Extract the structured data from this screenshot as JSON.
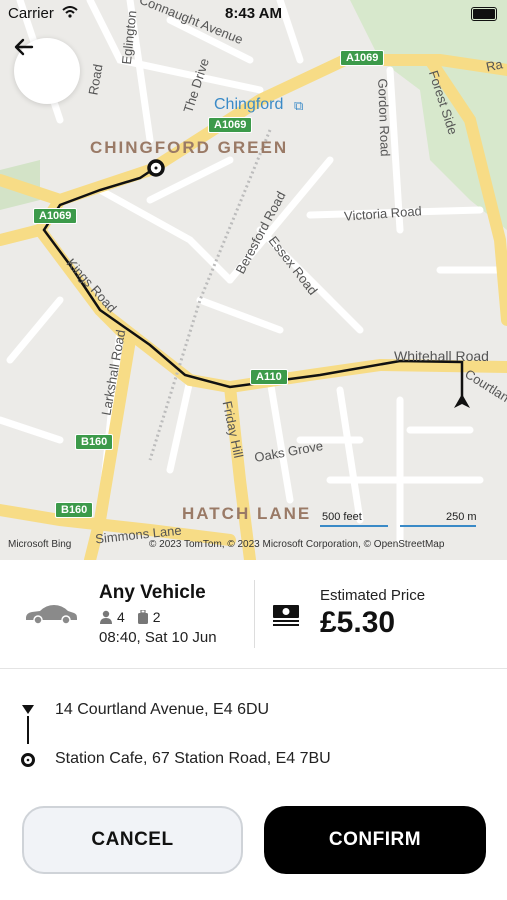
{
  "status_bar": {
    "carrier": "Carrier",
    "time": "8:43 AM"
  },
  "map": {
    "streets": [
      "Connaught Avenue",
      "Eglington",
      "Road",
      "The Drive",
      "Gordon Road",
      "Forest Side",
      "Victoria Road",
      "Beresford Road",
      "Essex Road",
      "Whitehall Road",
      "Kings Road",
      "Larkshall Road",
      "Friday Hill",
      "Oaks Grove",
      "Simmons Lane",
      "Courtland",
      "Ra"
    ],
    "areas": [
      "CHINGFORD GREEN",
      "HATCH LANE"
    ],
    "station": "Chingford",
    "shields": [
      "A1069",
      "A1069",
      "A1069",
      "A110",
      "B160",
      "B160"
    ],
    "scale": {
      "imperial": "500 feet",
      "metric": "250 m"
    },
    "attribution": "© 2023 TomTom, © 2023 Microsoft Corporation, © OpenStreetMap",
    "provider": "Microsoft Bing"
  },
  "vehicle": {
    "name": "Any Vehicle",
    "passengers": "4",
    "luggage": "2",
    "datetime": "08:40, Sat 10 Jun"
  },
  "price": {
    "label": "Estimated Price",
    "value": "£5.30"
  },
  "route": {
    "pickup": "14 Courtland Avenue, E4 6DU",
    "dropoff": "Station Cafe, 67 Station Road, E4 7BU"
  },
  "buttons": {
    "cancel": "CANCEL",
    "confirm": "CONFIRM"
  }
}
